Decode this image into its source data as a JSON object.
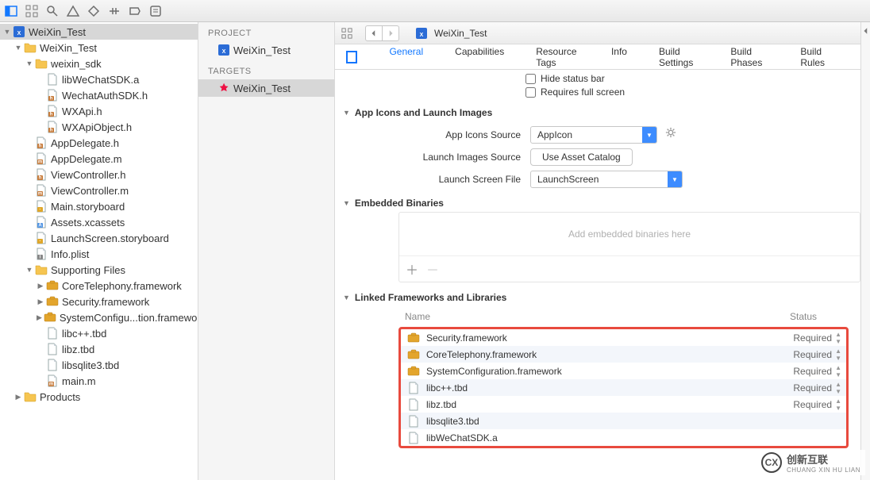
{
  "breadcrumb": {
    "file": "WeiXin_Test"
  },
  "nav": {
    "root_project": "WeiXin_Test",
    "root_group": "WeiXin_Test",
    "sdk_group": "weixin_sdk",
    "sdk_files": [
      "libWeChatSDK.a",
      "WechatAuthSDK.h",
      "WXApi.h",
      "WXApiObject.h"
    ],
    "app_files": [
      "AppDelegate.h",
      "AppDelegate.m",
      "ViewController.h",
      "ViewController.m",
      "Main.storyboard",
      "Assets.xcassets",
      "LaunchScreen.storyboard",
      "Info.plist"
    ],
    "supporting_group": "Supporting Files",
    "support_frameworks": [
      "CoreTelephony.framework",
      "Security.framework",
      "SystemConfigu...tion.framework"
    ],
    "support_files": [
      "libc++.tbd",
      "libz.tbd",
      "libsqlite3.tbd",
      "main.m"
    ],
    "products_group": "Products"
  },
  "mid": {
    "project_hdr": "PROJECT",
    "project_item": "WeiXin_Test",
    "targets_hdr": "TARGETS",
    "target_item": "WeiXin_Test"
  },
  "tabs": [
    "General",
    "Capabilities",
    "Resource Tags",
    "Info",
    "Build Settings",
    "Build Phases",
    "Build Rules"
  ],
  "active_tab": 0,
  "status_checks": {
    "hide_status": "Hide status bar",
    "full_screen": "Requires full screen"
  },
  "sections": {
    "icons": {
      "title": "App Icons and Launch Images",
      "app_icons_lbl": "App Icons Source",
      "app_icons_val": "AppIcon",
      "launch_images_lbl": "Launch Images Source",
      "launch_images_btn": "Use Asset Catalog",
      "launch_file_lbl": "Launch Screen File",
      "launch_file_val": "LaunchScreen"
    },
    "embedded": {
      "title": "Embedded Binaries",
      "placeholder": "Add embedded binaries here"
    },
    "linked": {
      "title": "Linked Frameworks and Libraries",
      "name_hdr": "Name",
      "status_hdr": "Status",
      "rows": [
        {
          "name": "Security.framework",
          "status": "Required",
          "type": "fw"
        },
        {
          "name": "CoreTelephony.framework",
          "status": "Required",
          "type": "fw"
        },
        {
          "name": "SystemConfiguration.framework",
          "status": "Required",
          "type": "fw"
        },
        {
          "name": "libc++.tbd",
          "status": "Required",
          "type": "doc"
        },
        {
          "name": "libz.tbd",
          "status": "Required",
          "type": "doc"
        },
        {
          "name": "libsqlite3.tbd",
          "status": "",
          "type": "doc"
        },
        {
          "name": "libWeChatSDK.a",
          "status": "",
          "type": "doc"
        }
      ]
    }
  },
  "watermark": {
    "text": "创新互联",
    "sub": "CHUANG XIN HU LIAN",
    "logo": "CX"
  }
}
